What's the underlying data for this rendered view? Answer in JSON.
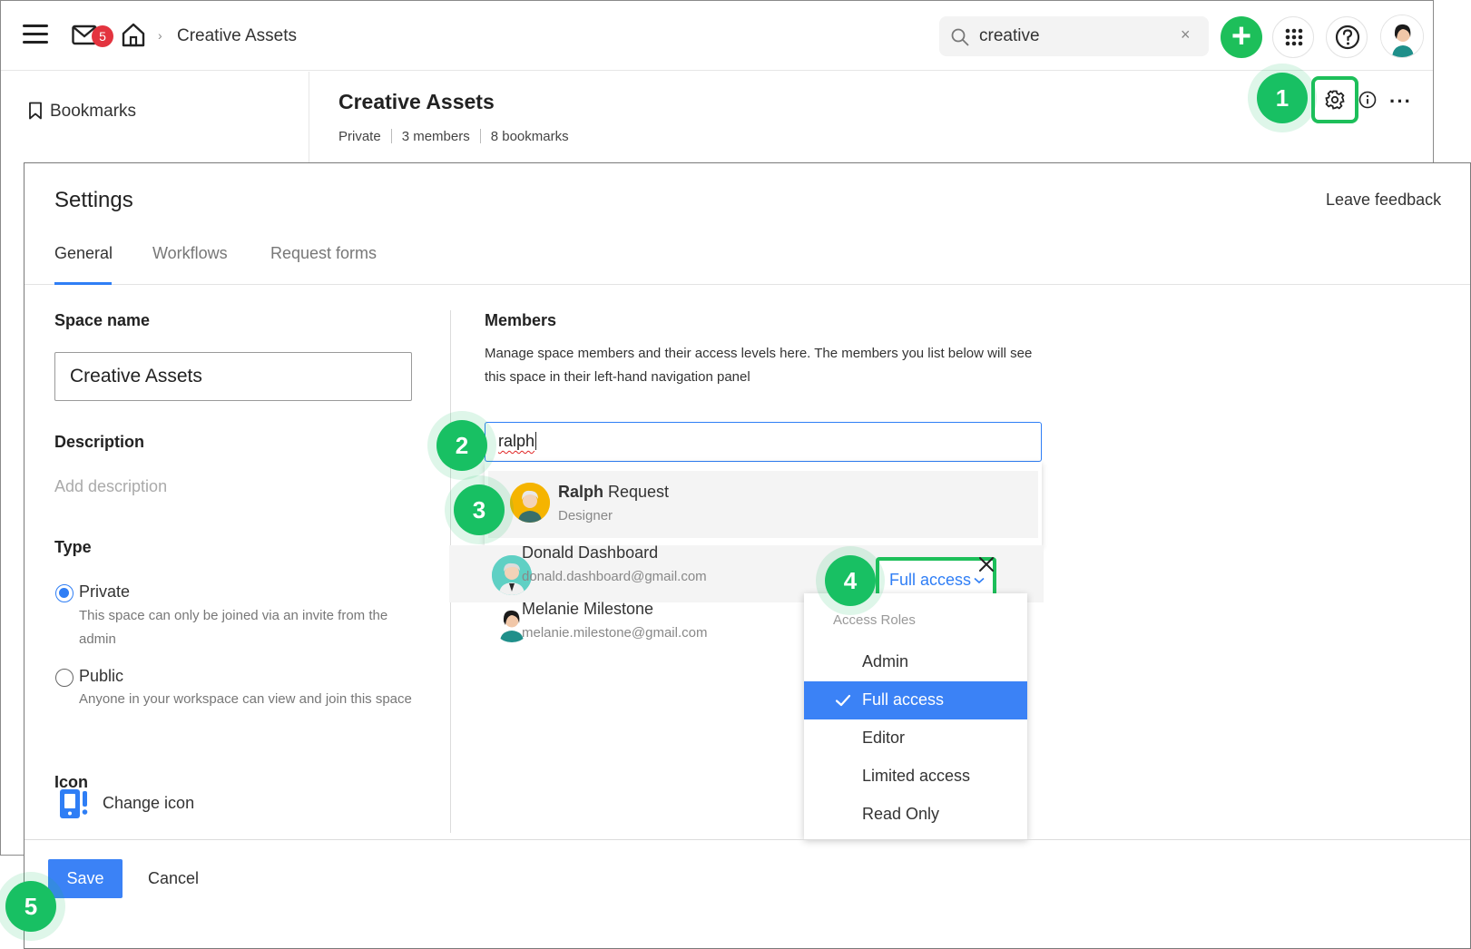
{
  "header": {
    "breadcrumb": "Creative Assets",
    "mail_badge": "5",
    "search": {
      "value": "creative",
      "clear": "×"
    },
    "plus_label": "+"
  },
  "sidebar": {
    "bookmarks_label": "Bookmarks"
  },
  "space": {
    "title": "Creative Assets",
    "visibility": "Private",
    "members": "3 members",
    "bookmarks": "8 bookmarks",
    "more": "···"
  },
  "steps": [
    "1",
    "2",
    "3",
    "4",
    "5"
  ],
  "settings": {
    "title": "Settings",
    "leave_feedback": "Leave feedback",
    "tabs": [
      "General",
      "Workflows",
      "Request forms"
    ],
    "space_name_label": "Space name",
    "space_name_value": "Creative Assets",
    "description_label": "Description",
    "description_placeholder": "Add description",
    "type_label": "Type",
    "private_label": "Private",
    "private_desc": "This space can only be joined via an invite from the admin",
    "public_label": "Public",
    "public_desc": "Anyone in your workspace can view and join this space",
    "icon_label": "Icon",
    "change_icon": "Change icon",
    "members_label": "Members",
    "members_desc": "Manage space members and their access levels here. The members you list below will see this space in their left-hand navigation panel",
    "member_search_value": "ralph",
    "suggestion": {
      "first": "Ralph",
      "last": " Request",
      "role": "Designer"
    },
    "members": [
      {
        "name": "Donald Dashboard",
        "email": "donald.dashboard@gmail.com"
      },
      {
        "name": "Melanie Milestone",
        "email": "melanie.milestone@gmail.com"
      }
    ],
    "access_current": "Full access",
    "access_menu": {
      "heading": "Access Roles",
      "options": [
        "Admin",
        "Full access",
        "Editor",
        "Limited access",
        "Read Only"
      ],
      "selected": "Full access"
    },
    "remove_symbol": "×",
    "save": "Save",
    "cancel": "Cancel"
  },
  "colors": {
    "accent_blue": "#3b82f6",
    "brand_green": "#1dbf5a",
    "badge_red": "#e3343f"
  }
}
